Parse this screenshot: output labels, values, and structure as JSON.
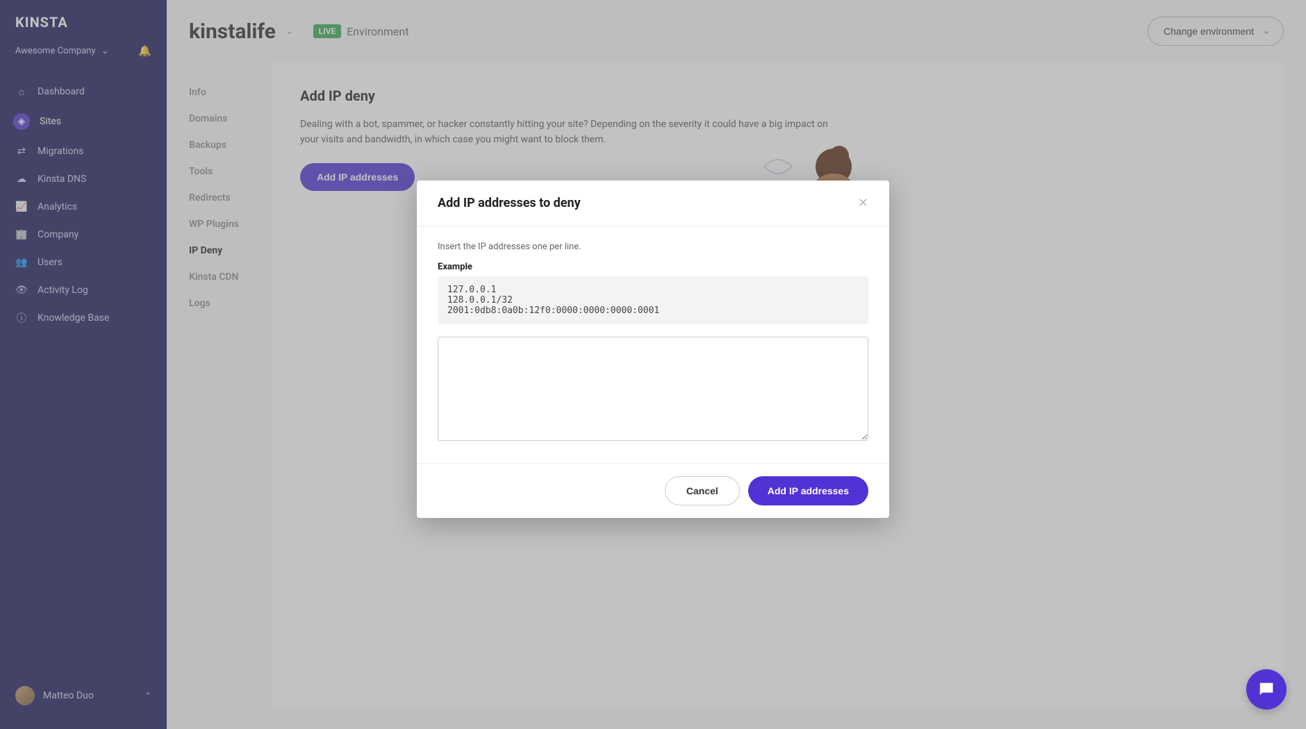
{
  "brand": "KINSTA",
  "company_selector": {
    "name": "Awesome Company"
  },
  "nav": [
    {
      "label": "Dashboard",
      "icon": "home-icon"
    },
    {
      "label": "Sites",
      "icon": "sites-icon",
      "active": true
    },
    {
      "label": "Migrations",
      "icon": "migrations-icon"
    },
    {
      "label": "Kinsta DNS",
      "icon": "dns-icon"
    },
    {
      "label": "Analytics",
      "icon": "analytics-icon"
    },
    {
      "label": "Company",
      "icon": "company-icon"
    },
    {
      "label": "Users",
      "icon": "users-icon"
    },
    {
      "label": "Activity Log",
      "icon": "activity-icon"
    },
    {
      "label": "Knowledge Base",
      "icon": "help-icon"
    }
  ],
  "user": {
    "name": "Matteo Duo"
  },
  "topbar": {
    "site_name": "kinstalife",
    "env_badge": "LIVE",
    "env_label": "Environment",
    "change_env": "Change environment"
  },
  "subnav": [
    "Info",
    "Domains",
    "Backups",
    "Tools",
    "Redirects",
    "WP Plugins",
    "IP Deny",
    "Kinsta CDN",
    "Logs"
  ],
  "subnav_active_index": 6,
  "panel": {
    "title": "Add IP deny",
    "description": "Dealing with a bot, spammer, or hacker constantly hitting your site? Depending on the severity it could have a big impact on your visits and bandwidth, in which case you might want to block them.",
    "button": "Add IP addresses"
  },
  "modal": {
    "title": "Add IP addresses to deny",
    "hint": "Insert the IP addresses one per line.",
    "example_label": "Example",
    "example_text": "127.0.0.1\n128.0.0.1/32\n2001:0db8:0a0b:12f0:0000:0000:0000:0001",
    "textarea_value": "",
    "cancel": "Cancel",
    "submit": "Add IP addresses"
  }
}
